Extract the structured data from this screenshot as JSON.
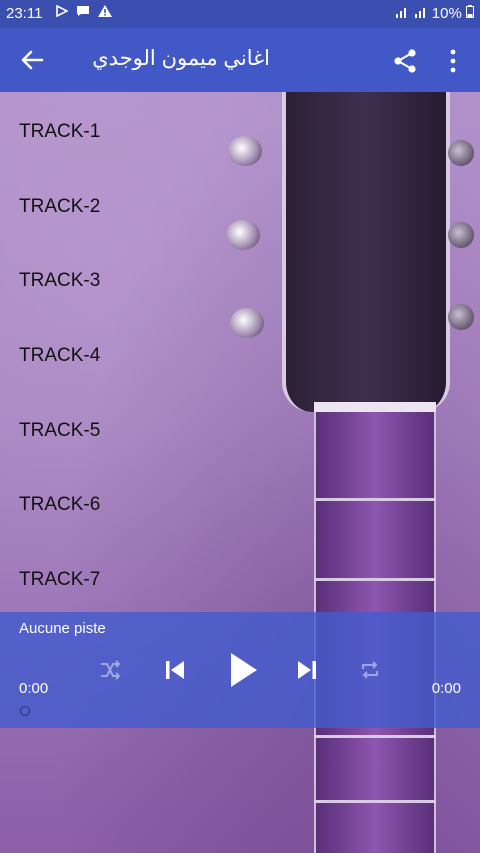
{
  "status": {
    "time": "23:11",
    "battery": "10%"
  },
  "toolbar": {
    "title": "اغاني ميمون الوجدي",
    "back_icon": "arrow-left-icon",
    "share_icon": "share-icon",
    "more_icon": "more-vert-icon"
  },
  "tracks": [
    "TRACK-1",
    "TRACK-2",
    "TRACK-3",
    "TRACK-4",
    "TRACK-5",
    "TRACK-6",
    "TRACK-7"
  ],
  "player": {
    "current_track": "Aucune piste",
    "elapsed": "0:00",
    "duration": "0:00",
    "progress": 0
  },
  "colors": {
    "statusbar": "#3a4fb0",
    "toolbar": "#4358c7",
    "player": "#445ccd"
  }
}
